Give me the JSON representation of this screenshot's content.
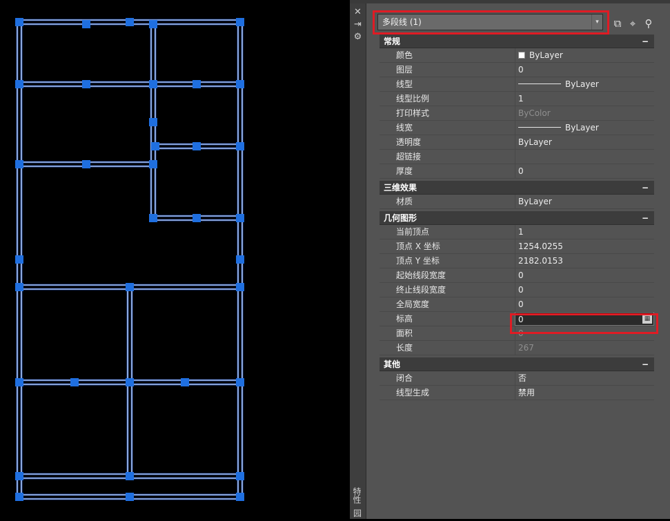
{
  "object_selector": {
    "value": "多段线 (1)"
  },
  "toolbar": {
    "toggle_pickadd_icon": "toggle-pickadd-icon",
    "select_objects_icon": "select-objects-icon",
    "quick_select_icon": "quick-select-icon"
  },
  "palette_bar": {
    "title": "特性",
    "bottom_label": "园"
  },
  "sections": {
    "general": {
      "title": "常规",
      "rows": [
        {
          "name": "颜色",
          "value": "ByLayer"
        },
        {
          "name": "图层",
          "value": "0"
        },
        {
          "name": "线型",
          "value": "ByLayer"
        },
        {
          "name": "线型比例",
          "value": "1"
        },
        {
          "name": "打印样式",
          "value": "ByColor"
        },
        {
          "name": "线宽",
          "value": "ByLayer"
        },
        {
          "name": "透明度",
          "value": "ByLayer"
        },
        {
          "name": "超链接",
          "value": ""
        },
        {
          "name": "厚度",
          "value": "0"
        }
      ]
    },
    "three_d": {
      "title": "三维效果",
      "rows": [
        {
          "name": "材质",
          "value": "ByLayer"
        }
      ]
    },
    "geometry": {
      "title": "几何图形",
      "rows": [
        {
          "name": "当前顶点",
          "value": "1"
        },
        {
          "name": "顶点 X 坐标",
          "value": "1254.0255"
        },
        {
          "name": "顶点 Y 坐标",
          "value": "2182.0153"
        },
        {
          "name": "起始线段宽度",
          "value": "0"
        },
        {
          "name": "终止线段宽度",
          "value": "0"
        },
        {
          "name": "全局宽度",
          "value": "0"
        },
        {
          "name": "标高",
          "value": "0"
        },
        {
          "name": "面积",
          "value": "0"
        },
        {
          "name": "长度",
          "value": "267"
        }
      ]
    },
    "misc": {
      "title": "其他",
      "rows": [
        {
          "name": "闭合",
          "value": "否"
        },
        {
          "name": "线型生成",
          "value": "禁用"
        }
      ]
    }
  },
  "collapse_symbol": "−",
  "colors": {
    "canvas_bg": "#000000",
    "polyline": "#a9c8ff",
    "grip": "#1f6fe0",
    "highlight": "#e01b24",
    "palette_bg": "#535353"
  }
}
